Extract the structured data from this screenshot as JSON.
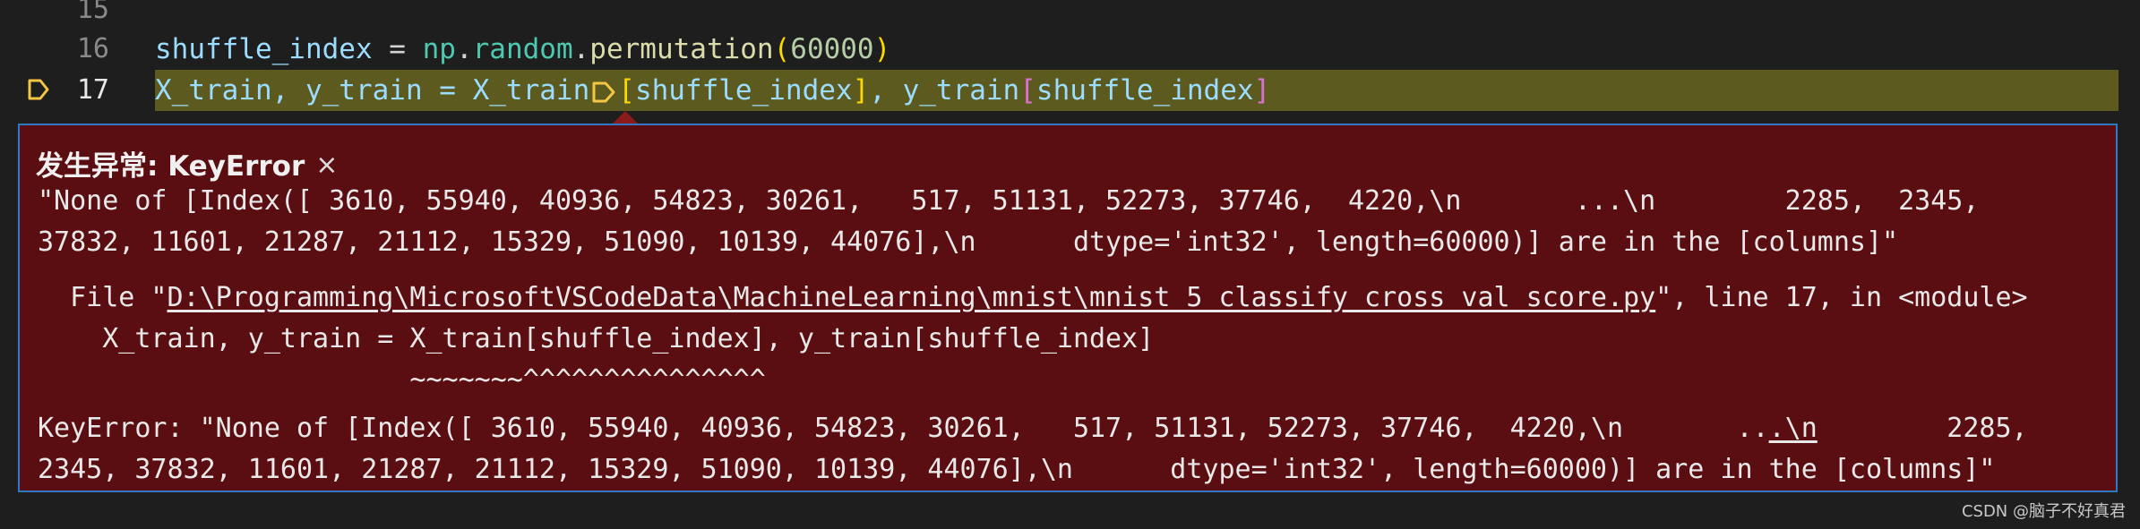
{
  "editor": {
    "line_numbers": [
      "15",
      "16",
      "17"
    ],
    "line16": {
      "var": "shuffle_index",
      "assign": " = ",
      "module": "np",
      "dot1": ".",
      "submodule": "random",
      "dot2": ".",
      "func": "permutation",
      "open": "(",
      "arg": "60000",
      "close": ")"
    },
    "line17": {
      "lhs": "X_train, y_train = X_train",
      "sub1_open": "[",
      "sub1_arg": "shuffle_index",
      "sub1_close": "]",
      "mid": ", y_train",
      "sub2_open": "[",
      "sub2_arg": "shuffle_index",
      "sub2_close": "]"
    }
  },
  "exception": {
    "title": "发生异常: KeyError",
    "close_glyph": "×",
    "message_line1": "\"None of [Index([ 3610, 55940, 40936, 54823, 30261,   517, 51131, 52273, 37746,  4220,\\n       ...\\n        2285,  2345,",
    "message_line2": "37832, 11601, 21287, 21112, 15329, 51090, 10139, 44076],\\n      dtype='int32', length=60000)] are in the [columns]\"",
    "file_prefix": "  File \"",
    "file_path": "D:\\Programming\\MicrosoftVSCodeData\\MachineLearning\\mnist\\mnist_5_classify_cross_val_score.py",
    "file_suffix": "\", line 17, in <module>",
    "code_line": "    X_train, y_train = X_train[shuffle_index], y_train[shuffle_index]",
    "marker_line": "                       ~~~~~~~^^^^^^^^^^^^^^^",
    "error_line1_a": "KeyError: \"None of [Index([ 3610, 55940, 40936, 54823, 30261,   517, 51131, 52273, 37746,  4220,\\n       ..",
    "error_line1_link": ".\\n",
    "error_line1_b": "        2285,",
    "error_line2": "2345, 37832, 11601, 21287, 21112, 15329, 51090, 10139, 44076],\\n      dtype='int32', length=60000)] are in the [columns]\""
  },
  "watermark": "CSDN @脑子不好真君",
  "colors": {
    "background": "#1e1e1e",
    "exception_bg": "#5a0e12",
    "exception_border": "#2f78c6",
    "current_line": "#5d5a1f",
    "breakpoint": "#f2c744"
  },
  "icons": {
    "gutter_marker": "debug-stackframe-icon",
    "inline_marker": "inline-breakpoint-icon",
    "close": "close-icon"
  }
}
